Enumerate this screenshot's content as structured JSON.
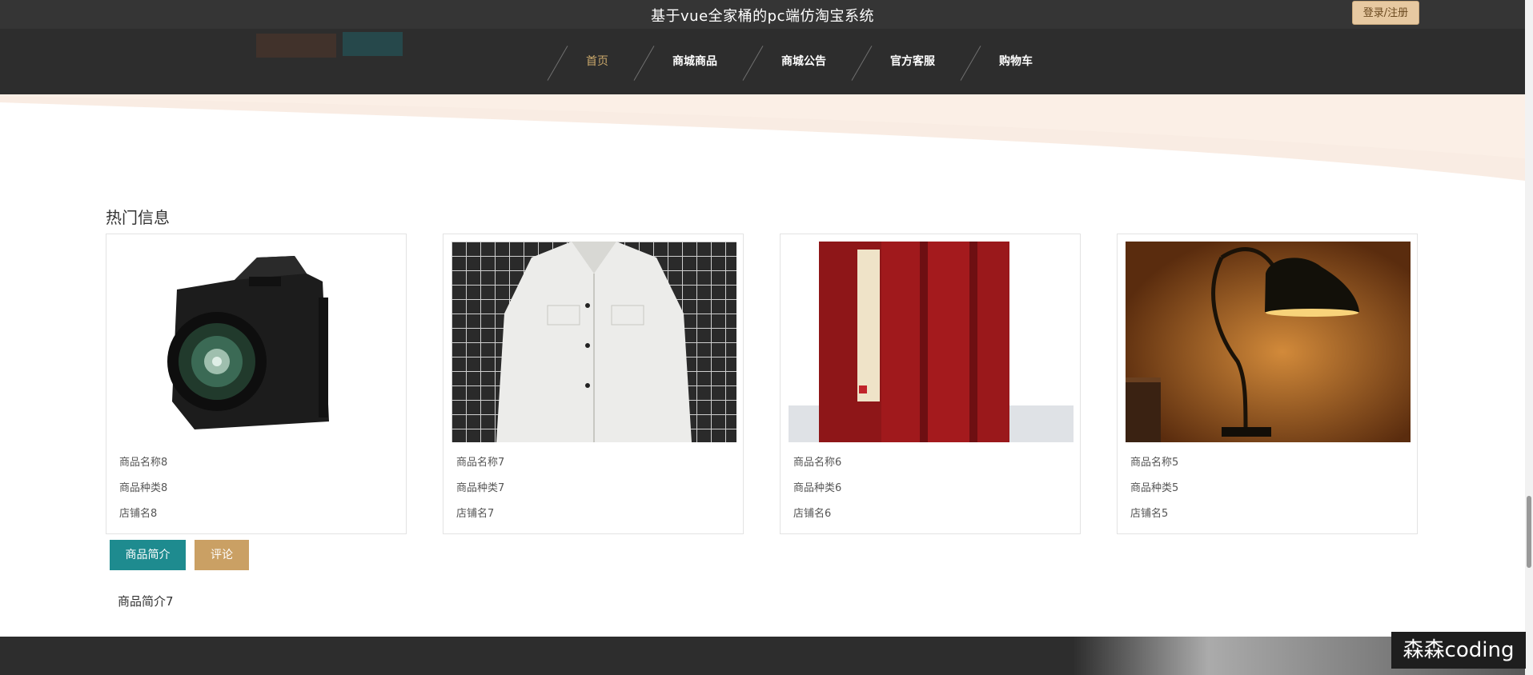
{
  "header": {
    "title": "基于vue全家桶的pc端仿淘宝系统",
    "login_label": "登录/注册"
  },
  "nav": {
    "items": [
      {
        "label": "首页",
        "active": true
      },
      {
        "label": "商城商品"
      },
      {
        "label": "商城公告"
      },
      {
        "label": "官方客服"
      },
      {
        "label": "购物车"
      }
    ]
  },
  "hot": {
    "title": "热门信息",
    "items": [
      {
        "name": "商品名称8",
        "category": "商品种类8",
        "shop": "店铺名8",
        "image": "camera"
      },
      {
        "name": "商品名称7",
        "category": "商品种类7",
        "shop": "店铺名7",
        "image": "jacket"
      },
      {
        "name": "商品名称6",
        "category": "商品种类6",
        "shop": "店铺名6",
        "image": "books"
      },
      {
        "name": "商品名称5",
        "category": "商品种类5",
        "shop": "店铺名5",
        "image": "lamp"
      }
    ]
  },
  "tabs": {
    "intro_label": "商品简介",
    "comment_label": "评论"
  },
  "intro_text": "商品简介7",
  "watermark": "森森coding",
  "colors": {
    "header_bg": "#353535",
    "nav_bg": "#2d2d2d",
    "accent_gold": "#c9a76a",
    "teal": "#1e8b8f",
    "tan": "#caa064"
  }
}
